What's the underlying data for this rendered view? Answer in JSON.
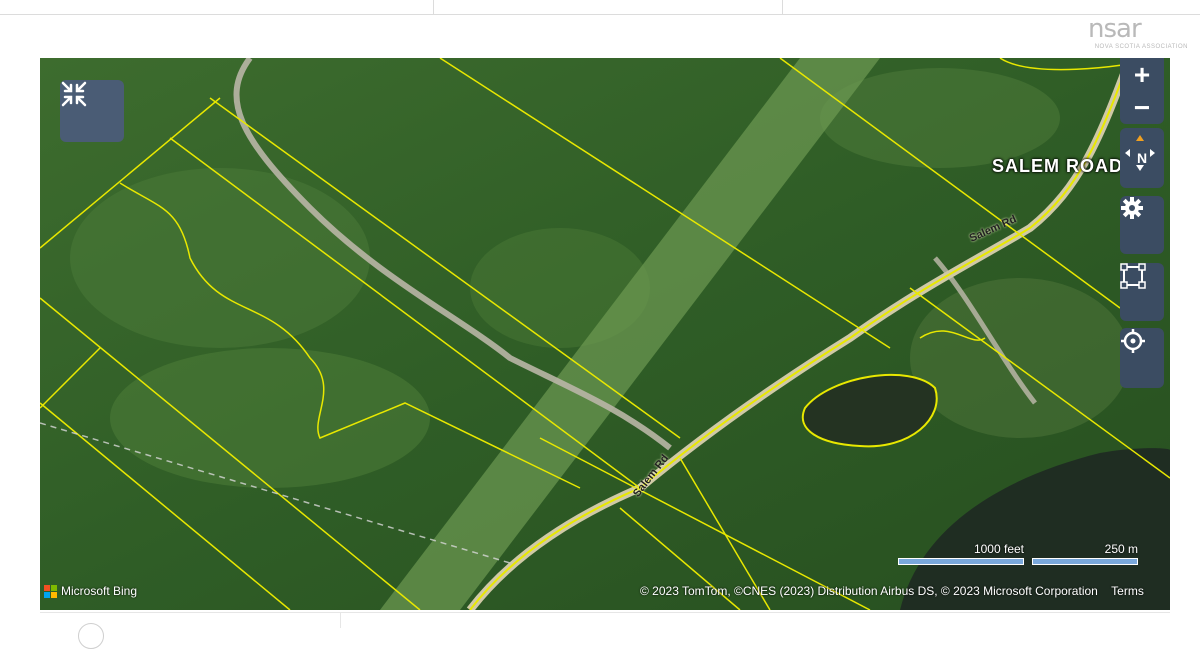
{
  "brand": {
    "wordmark": "nsar",
    "subtitle": "NOVA SCOTIA ASSOCIATION"
  },
  "map": {
    "place_label": "SALEM ROAD",
    "road_labels": [
      "Salem Rd",
      "Salem Rd"
    ],
    "attribution": "© 2023 TomTom, ©CNES (2023) Distribution Airbus DS, © 2023 Microsoft Corporation",
    "terms_link": "Terms",
    "bing_label": "Microsoft Bing",
    "scale_feet": "1000 feet",
    "scale_meters": "250 m",
    "colors": {
      "parcel_lines": "#e8e800",
      "control_bg": "#3b4c62",
      "scale_bar": "#7aa8dc"
    }
  },
  "controls": {
    "collapse_icon": "collapse-arrows-icon",
    "zoom_in": "+",
    "zoom_out": "−",
    "compass_label": "N",
    "settings_icon": "gear-icon",
    "frame_icon": "frame-select-icon",
    "locate_icon": "crosshair-icon"
  }
}
